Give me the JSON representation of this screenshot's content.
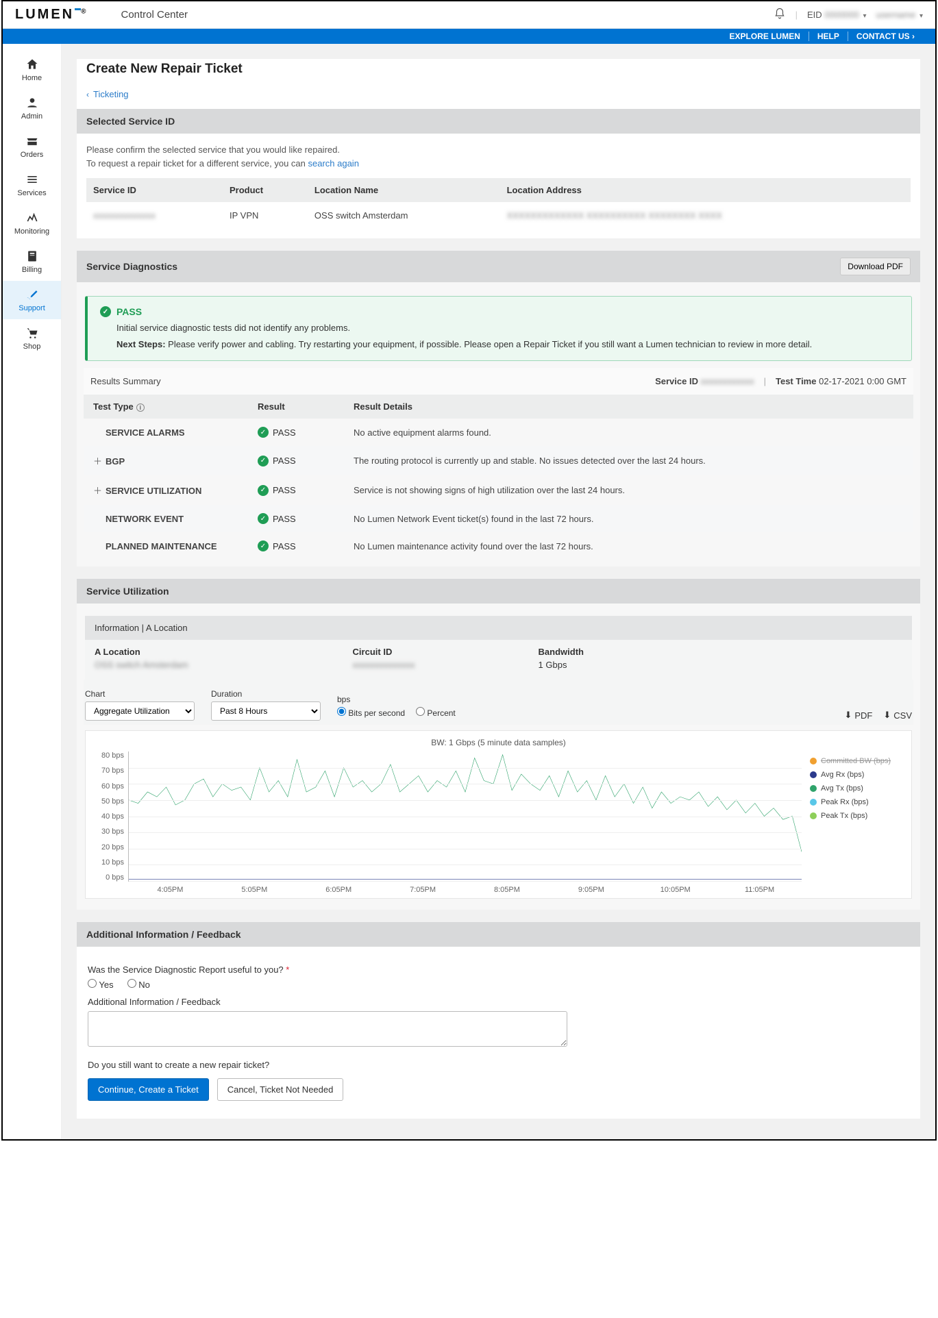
{
  "header": {
    "brand": "LUMEN",
    "app_title": "Control Center",
    "eid_label": "EID",
    "eid_value": "0000000",
    "user_value": "username"
  },
  "blue_links": [
    "EXPLORE LUMEN",
    "HELP",
    "CONTACT US ›"
  ],
  "sidebar": {
    "items": [
      {
        "label": "Home"
      },
      {
        "label": "Admin"
      },
      {
        "label": "Orders"
      },
      {
        "label": "Services"
      },
      {
        "label": "Monitoring"
      },
      {
        "label": "Billing"
      },
      {
        "label": "Support"
      },
      {
        "label": "Shop"
      }
    ]
  },
  "page": {
    "title": "Create New Repair Ticket",
    "breadcrumb": "Ticketing"
  },
  "selected_service": {
    "header": "Selected Service ID",
    "note_line1": "Please confirm the selected service that you would like repaired.",
    "note_line2_a": "To request a repair ticket for a different service, you can ",
    "note_line2_link": "search again",
    "columns": [
      "Service ID",
      "Product",
      "Location Name",
      "Location Address"
    ],
    "row": {
      "service_id": "xxxxxxxxxxxxxx",
      "product": "IP VPN",
      "location_name": "OSS switch Amsterdam",
      "location_address": "XXXXXXXXXXXXX  XXXXXXXXXX  XXXXXXXX  XXXX"
    }
  },
  "diagnostics": {
    "header": "Service Diagnostics",
    "download": "Download PDF",
    "pass_title": "PASS",
    "pass_msg": "Initial service diagnostic tests did not identify any problems.",
    "next_label": "Next Steps:",
    "next_msg": " Please verify power and cabling. Try restarting your equipment, if possible. Please open a Repair Ticket if you still want a Lumen technician to review in more detail.",
    "summary_label": "Results Summary",
    "service_id_label": "Service ID",
    "service_id_value": "xxxxxxxxxxxx",
    "test_time_label": "Test Time",
    "test_time_value": "02-17-2021 0:00 GMT",
    "columns": [
      "Test Type",
      "Result",
      "Result Details"
    ],
    "rows": [
      {
        "expand": false,
        "type": "SERVICE ALARMS",
        "result": "PASS",
        "details": "No active equipment alarms found."
      },
      {
        "expand": true,
        "type": "BGP",
        "result": "PASS",
        "details": "The routing protocol is currently up and stable. No issues detected over the last 24 hours."
      },
      {
        "expand": true,
        "type": "SERVICE UTILIZATION",
        "result": "PASS",
        "details": "Service is not showing signs of high utilization over the last 24 hours."
      },
      {
        "expand": false,
        "type": "NETWORK EVENT",
        "result": "PASS",
        "details": "No Lumen Network Event ticket(s) found in the last 72 hours."
      },
      {
        "expand": false,
        "type": "PLANNED MAINTENANCE",
        "result": "PASS",
        "details": "No Lumen maintenance activity found over the last 72 hours."
      }
    ]
  },
  "utilization": {
    "header": "Service Utilization",
    "info_header": "Information  |  A Location",
    "a_location_label": "A Location",
    "a_location_value": "OSS switch Amsterdam",
    "circuit_label": "Circuit ID",
    "circuit_value": "xxxxxxxxxxxxxx",
    "bandwidth_label": "Bandwidth",
    "bandwidth_value": "1 Gbps",
    "chart_label": "Chart",
    "chart_select": "Aggregate Utilization",
    "duration_label": "Duration",
    "duration_select": "Past 8 Hours",
    "bps_label": "bps",
    "radio_bps": "Bits per second",
    "radio_percent": "Percent",
    "export_pdf": "PDF",
    "export_csv": "CSV",
    "chart_title": "BW: 1 Gbps    (5 minute data samples)",
    "legend": [
      {
        "name": "Committed BW (bps)",
        "color": "#f0a030",
        "strike": true
      },
      {
        "name": "Avg Rx (bps)",
        "color": "#2b3a8c",
        "strike": false
      },
      {
        "name": "Avg Tx (bps)",
        "color": "#2fa36b",
        "strike": false
      },
      {
        "name": "Peak Rx (bps)",
        "color": "#59c7e8",
        "strike": false
      },
      {
        "name": "Peak Tx (bps)",
        "color": "#8ecf5a",
        "strike": false
      }
    ]
  },
  "feedback": {
    "header": "Additional Information / Feedback",
    "q1": "Was the Service Diagnostic Report useful to you?",
    "yes": "Yes",
    "no": "No",
    "area_label": "Additional Information / Feedback",
    "q2": "Do you still want to create a new repair ticket?",
    "btn_continue": "Continue, Create a Ticket",
    "btn_cancel": "Cancel, Ticket Not Needed"
  },
  "chart_data": {
    "type": "line",
    "title": "BW: 1 Gbps (5 minute data samples)",
    "ylabel": "bps",
    "ylim": [
      0,
      80
    ],
    "y_ticks": [
      "80 bps",
      "70 bps",
      "60 bps",
      "50 bps",
      "40 bps",
      "30 bps",
      "20 bps",
      "10 bps",
      "0 bps"
    ],
    "x_ticks": [
      "4:05PM",
      "5:05PM",
      "6:05PM",
      "7:05PM",
      "8:05PM",
      "9:05PM",
      "10:05PM",
      "11:05PM"
    ],
    "series": [
      {
        "name": "Avg Tx (bps)",
        "color": "#2fa36b",
        "values": [
          50,
          48,
          55,
          52,
          58,
          47,
          50,
          60,
          63,
          52,
          60,
          56,
          58,
          50,
          70,
          55,
          62,
          52,
          75,
          55,
          58,
          68,
          52,
          70,
          58,
          62,
          55,
          60,
          72,
          55,
          60,
          65,
          55,
          62,
          58,
          68,
          55,
          76,
          62,
          60,
          78,
          56,
          66,
          60,
          56,
          65,
          52,
          68,
          55,
          62,
          50,
          65,
          52,
          60,
          48,
          58,
          45,
          55,
          48,
          52,
          50,
          55,
          46,
          52,
          44,
          50,
          42,
          48,
          40,
          45,
          38,
          40,
          18
        ]
      },
      {
        "name": "Avg Rx (bps)",
        "color": "#2b3a8c",
        "values": [
          1,
          1,
          1,
          1,
          1,
          1,
          1,
          1,
          1,
          1,
          1,
          1,
          1,
          1,
          1,
          1,
          1,
          1,
          1,
          1,
          1,
          1,
          1,
          1,
          1,
          1,
          1,
          1,
          1,
          1,
          1,
          1,
          1,
          1,
          1,
          1,
          1,
          1,
          1,
          1,
          1,
          1,
          1,
          1,
          1,
          1,
          1,
          1,
          1,
          1,
          1,
          1,
          1,
          1,
          1,
          1,
          1,
          1,
          1,
          1,
          1,
          1,
          1,
          1,
          1,
          1,
          1,
          1,
          1,
          1,
          1,
          1,
          1
        ]
      }
    ]
  }
}
